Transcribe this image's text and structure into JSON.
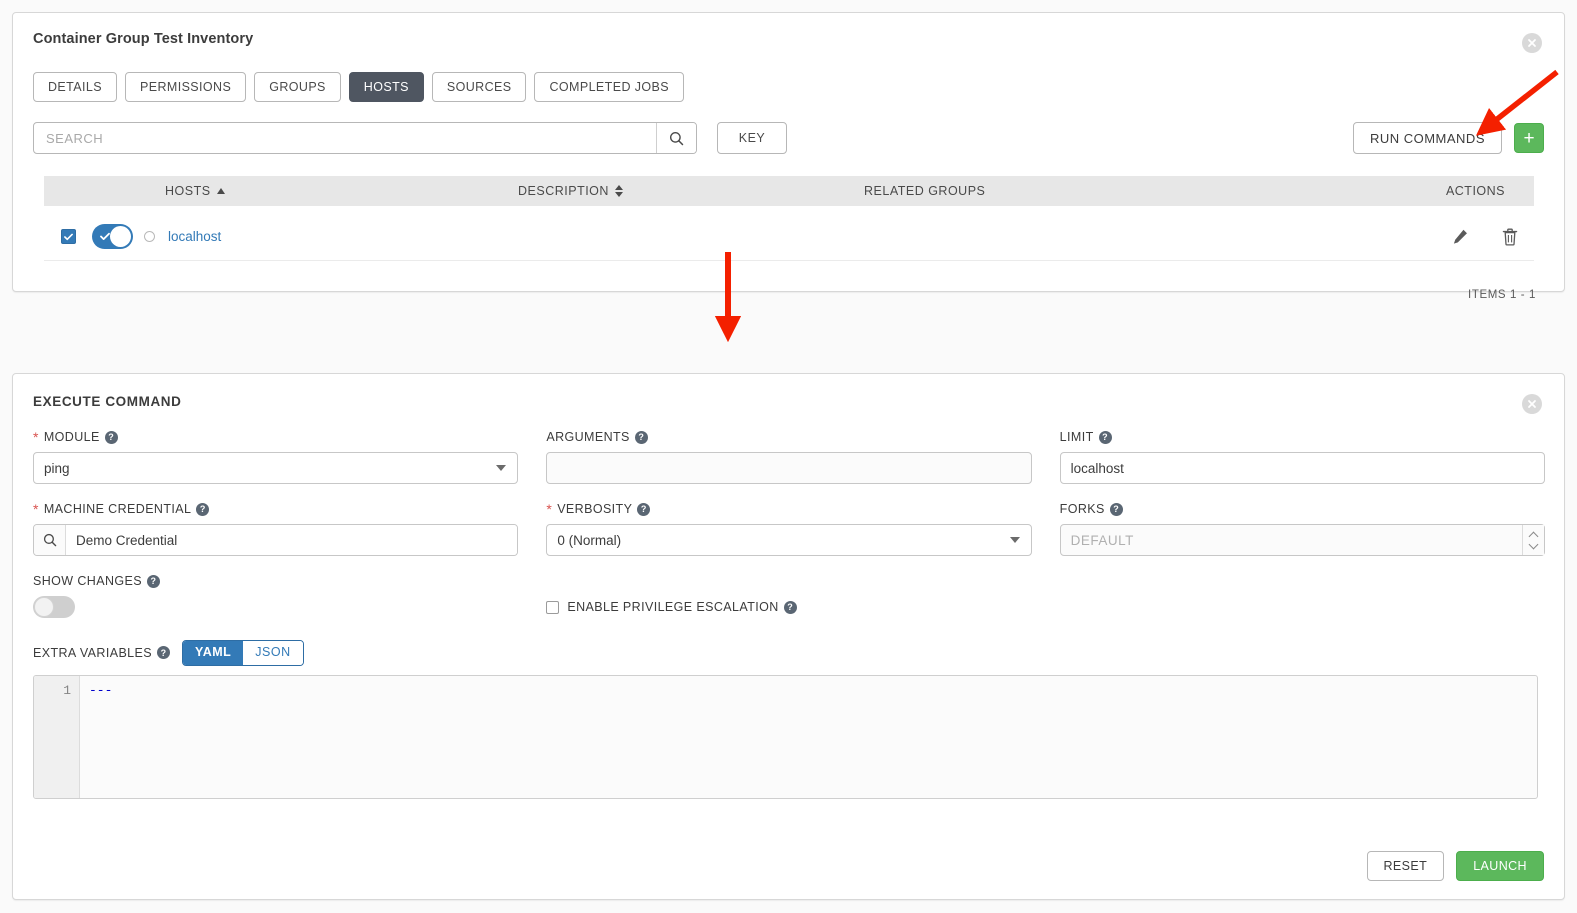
{
  "inventory": {
    "title": "Container Group Test Inventory",
    "tabs": [
      {
        "label": "DETAILS",
        "active": false
      },
      {
        "label": "PERMISSIONS",
        "active": false
      },
      {
        "label": "GROUPS",
        "active": false
      },
      {
        "label": "HOSTS",
        "active": true
      },
      {
        "label": "SOURCES",
        "active": false
      },
      {
        "label": "COMPLETED JOBS",
        "active": false
      }
    ],
    "search": {
      "placeholder": "SEARCH",
      "value": ""
    },
    "key_button": "KEY",
    "run_commands_button": "RUN COMMANDS",
    "add_button": "+",
    "table": {
      "columns": [
        "HOSTS",
        "DESCRIPTION",
        "RELATED GROUPS",
        "ACTIONS"
      ],
      "rows": [
        {
          "name": "localhost",
          "description": "",
          "related_groups": "",
          "selected": true,
          "enabled": true
        }
      ]
    },
    "items_count": "ITEMS  1 - 1"
  },
  "execute_command": {
    "title": "EXECUTE COMMAND",
    "fields": {
      "module": {
        "label": "MODULE",
        "value": "ping",
        "required": true
      },
      "arguments": {
        "label": "ARGUMENTS",
        "value": "",
        "required": false
      },
      "limit": {
        "label": "LIMIT",
        "value": "localhost",
        "required": false
      },
      "machine_credential": {
        "label": "MACHINE CREDENTIAL",
        "value": "Demo Credential",
        "required": true
      },
      "verbosity": {
        "label": "VERBOSITY",
        "value": "0 (Normal)",
        "required": true
      },
      "forks": {
        "label": "FORKS",
        "value": "",
        "placeholder": "DEFAULT",
        "required": false
      },
      "show_changes": {
        "label": "SHOW CHANGES",
        "value": false
      },
      "enable_privilege_escalation": {
        "label": "ENABLE PRIVILEGE ESCALATION",
        "value": false
      },
      "extra_variables": {
        "label": "EXTRA VARIABLES",
        "format_options": [
          "YAML",
          "JSON"
        ],
        "selected_format": "YAML",
        "line_number": "1",
        "content": "---"
      }
    },
    "reset_button": "RESET",
    "launch_button": "LAUNCH"
  },
  "colors": {
    "accent_blue": "#337ab7",
    "success_green": "#5cb85c",
    "active_tab": "#4f5661",
    "required_red": "#d9534f",
    "annotation_red": "#f42000"
  }
}
